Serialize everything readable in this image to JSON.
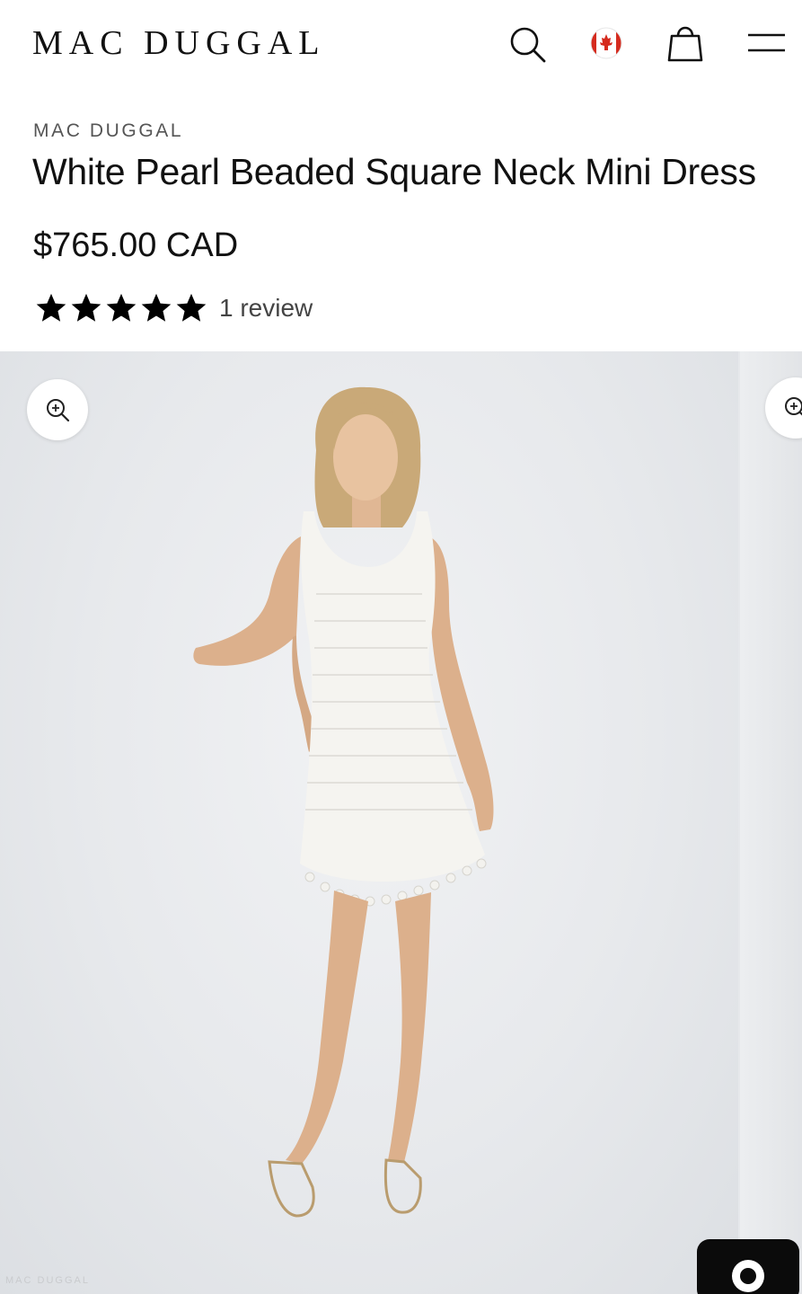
{
  "header": {
    "logo": "MAC DUGGAL",
    "icons": [
      "search-icon",
      "canada-flag-icon",
      "shopping-bag-icon",
      "menu-icon"
    ]
  },
  "product": {
    "brand": "MAC DUGGAL",
    "title": "White Pearl Beaded Square Neck Mini Dress",
    "price": "$765.00 CAD",
    "rating": {
      "stars": 5,
      "max": 5,
      "review_label": "1 review"
    }
  },
  "gallery": {
    "zoom_icon": "zoom-in-icon",
    "watermark": "MAC DUGGAL",
    "chat_icon": "chat-icon"
  },
  "colors": {
    "text": "#111111",
    "brand_label": "#555555",
    "photo_background": "#e6e8eb",
    "flag_red": "#d52b1e",
    "chat_button": "#0b0b0b"
  }
}
